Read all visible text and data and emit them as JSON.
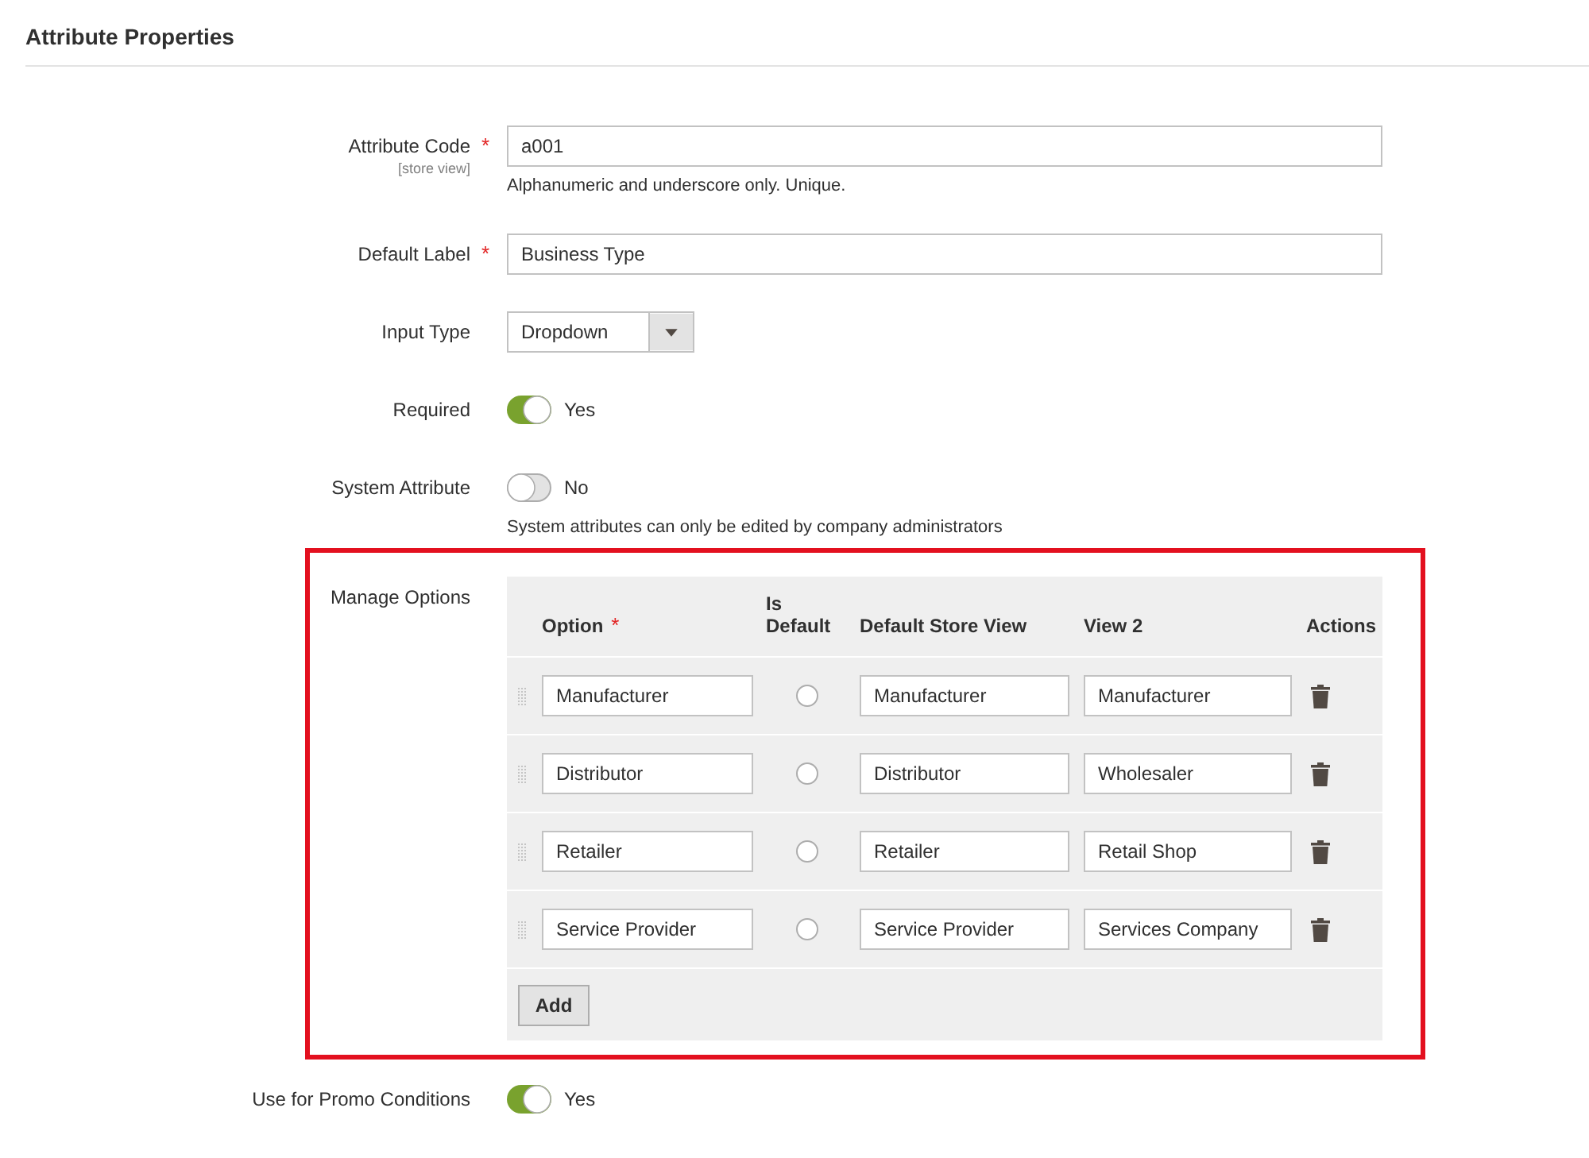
{
  "section_title": "Attribute Properties",
  "fields": [
    {
      "kind": "text",
      "label": "Attribute Code",
      "required_mark": "*",
      "scope": "[store view]",
      "value": "a001",
      "note": "Alphanumeric and underscore only. Unique."
    },
    {
      "kind": "text",
      "label": "Default Label",
      "required_mark": "*",
      "value": "Business Type"
    },
    {
      "kind": "select",
      "label": "Input Type",
      "value": "Dropdown"
    },
    {
      "kind": "toggle",
      "label": "Required",
      "on": true,
      "value": "Yes"
    },
    {
      "kind": "toggle",
      "label": "System Attribute",
      "on": false,
      "value": "No",
      "note": "System attributes can only be edited by company administrators"
    },
    {
      "kind": "options",
      "label": "Manage Options",
      "highlighted": true,
      "columns": [
        {
          "label": "Option",
          "required_mark": "*"
        },
        {
          "label": "Is Default"
        },
        {
          "label": "Default Store View"
        },
        {
          "label": "View 2"
        },
        {
          "label": "Actions"
        }
      ],
      "rows": [
        {
          "option": "Manufacturer",
          "is_default": false,
          "default_store_view": "Manufacturer",
          "view_2": "Manufacturer"
        },
        {
          "option": "Distributor",
          "is_default": false,
          "default_store_view": "Distributor",
          "view_2": "Wholesaler"
        },
        {
          "option": "Retailer",
          "is_default": false,
          "default_store_view": "Retailer",
          "view_2": "Retail Shop"
        },
        {
          "option": "Service Provider",
          "is_default": false,
          "default_store_view": "Service Provider",
          "view_2": "Services Company"
        }
      ],
      "add_button": "Add"
    },
    {
      "kind": "toggle",
      "label": "Use for Promo Conditions",
      "on": true,
      "value": "Yes"
    }
  ]
}
